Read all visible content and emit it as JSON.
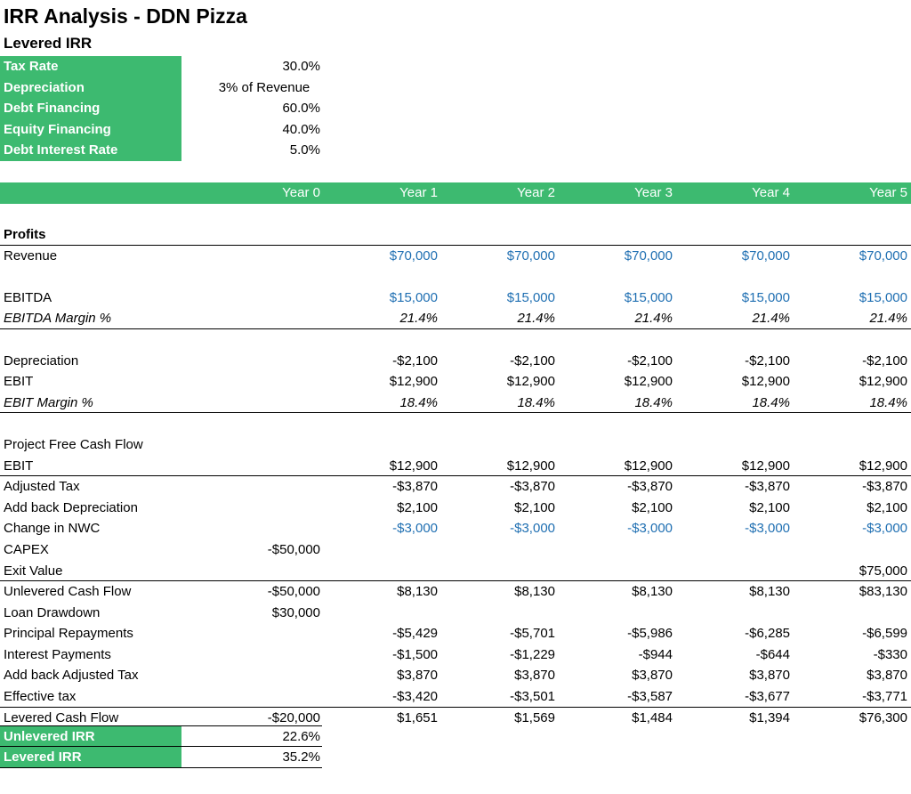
{
  "title": "IRR Analysis - DDN Pizza",
  "subtitle": "Levered IRR",
  "assumptions": [
    {
      "label": "Tax Rate",
      "value": "30.0%"
    },
    {
      "label": "Depreciation",
      "value": "3% of Revenue"
    },
    {
      "label": "Debt Financing",
      "value": "60.0%"
    },
    {
      "label": "Equity Financing",
      "value": "40.0%"
    },
    {
      "label": "Debt Interest Rate",
      "value": "5.0%"
    }
  ],
  "years": [
    "Year 0",
    "Year 1",
    "Year 2",
    "Year 3",
    "Year 4",
    "Year 5"
  ],
  "rows": {
    "profits": {
      "label": "Profits"
    },
    "revenue": {
      "label": "Revenue",
      "values": [
        "",
        "$70,000",
        "$70,000",
        "$70,000",
        "$70,000",
        "$70,000"
      ]
    },
    "ebitda": {
      "label": "EBITDA",
      "values": [
        "",
        "$15,000",
        "$15,000",
        "$15,000",
        "$15,000",
        "$15,000"
      ]
    },
    "ebitda_margin": {
      "label": "EBITDA Margin %",
      "values": [
        "",
        "21.4%",
        "21.4%",
        "21.4%",
        "21.4%",
        "21.4%"
      ]
    },
    "depreciation": {
      "label": "Depreciation",
      "values": [
        "",
        "-$2,100",
        "-$2,100",
        "-$2,100",
        "-$2,100",
        "-$2,100"
      ]
    },
    "ebit": {
      "label": "EBIT",
      "values": [
        "",
        "$12,900",
        "$12,900",
        "$12,900",
        "$12,900",
        "$12,900"
      ]
    },
    "ebit_margin": {
      "label": "EBIT Margin %",
      "values": [
        "",
        "18.4%",
        "18.4%",
        "18.4%",
        "18.4%",
        "18.4%"
      ]
    },
    "pfcf": {
      "label": "Project Free Cash Flow"
    },
    "ebit2": {
      "label": "EBIT",
      "values": [
        "",
        "$12,900",
        "$12,900",
        "$12,900",
        "$12,900",
        "$12,900"
      ]
    },
    "adj_tax": {
      "label": "Adjusted Tax",
      "values": [
        "",
        "-$3,870",
        "-$3,870",
        "-$3,870",
        "-$3,870",
        "-$3,870"
      ]
    },
    "add_dep": {
      "label": "Add back Depreciation",
      "values": [
        "",
        "$2,100",
        "$2,100",
        "$2,100",
        "$2,100",
        "$2,100"
      ]
    },
    "nwc": {
      "label": "Change in NWC",
      "values": [
        "",
        "-$3,000",
        "-$3,000",
        "-$3,000",
        "-$3,000",
        "-$3,000"
      ]
    },
    "capex": {
      "label": "CAPEX",
      "values": [
        "-$50,000",
        "",
        "",
        "",
        "",
        ""
      ]
    },
    "exit": {
      "label": "Exit Value",
      "values": [
        "",
        "",
        "",
        "",
        "",
        "$75,000"
      ]
    },
    "unlev": {
      "label": "Unlevered Cash Flow",
      "values": [
        "-$50,000",
        "$8,130",
        "$8,130",
        "$8,130",
        "$8,130",
        "$83,130"
      ]
    },
    "loan": {
      "label": "Loan Drawdown",
      "values": [
        "$30,000",
        "",
        "",
        "",
        "",
        ""
      ]
    },
    "principal": {
      "label": "Principal Repayments",
      "values": [
        "",
        "-$5,429",
        "-$5,701",
        "-$5,986",
        "-$6,285",
        "-$6,599"
      ]
    },
    "interest": {
      "label": "Interest Payments",
      "values": [
        "",
        "-$1,500",
        "-$1,229",
        "-$944",
        "-$644",
        "-$330"
      ]
    },
    "add_tax": {
      "label": "Add back Adjusted Tax",
      "values": [
        "",
        "$3,870",
        "$3,870",
        "$3,870",
        "$3,870",
        "$3,870"
      ]
    },
    "eff_tax": {
      "label": "Effective tax",
      "values": [
        "",
        "-$3,420",
        "-$3,501",
        "-$3,587",
        "-$3,677",
        "-$3,771"
      ]
    },
    "lev": {
      "label": "Levered Cash Flow",
      "values": [
        "-$20,000",
        "$1,651",
        "$1,569",
        "$1,484",
        "$1,394",
        "$76,300"
      ]
    }
  },
  "irr": [
    {
      "label": "Unlevered IRR",
      "value": "22.6%"
    },
    {
      "label": "Levered IRR",
      "value": "35.2%"
    }
  ],
  "colors": {
    "accent_green": "#3dba70",
    "input_blue": "#1f6fb2"
  }
}
